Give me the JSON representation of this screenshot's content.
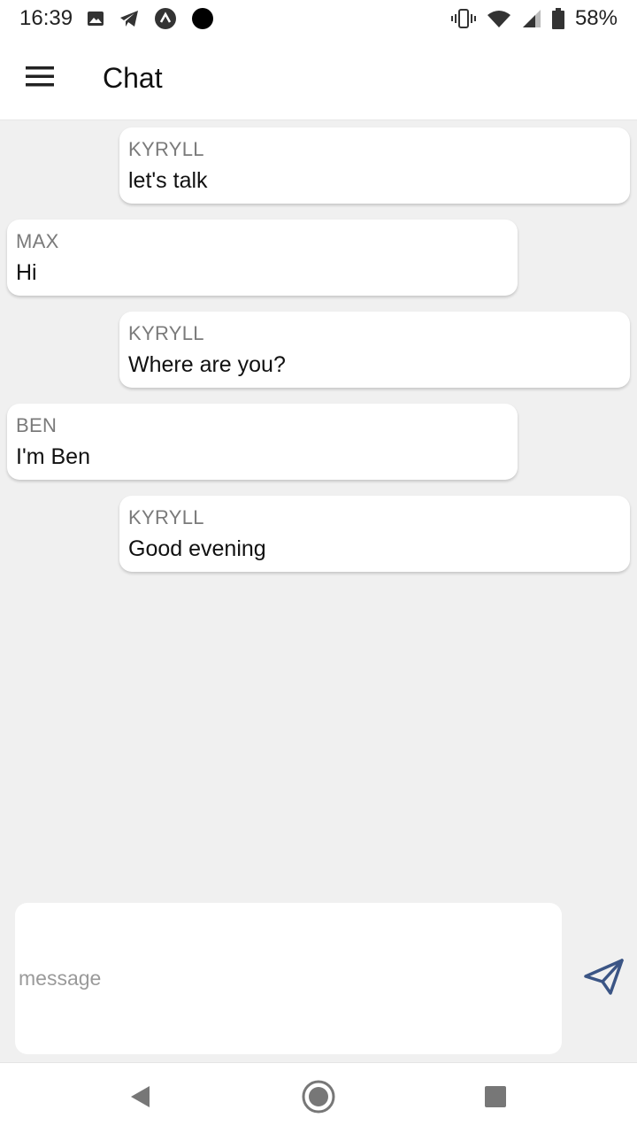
{
  "status_bar": {
    "time": "16:39",
    "battery": "58%",
    "icons": [
      "image-icon",
      "telegram-icon",
      "arc-icon",
      "dot-icon",
      "vibrate-icon",
      "wifi-icon",
      "signal-icon",
      "battery-icon"
    ]
  },
  "app_bar": {
    "title": "Chat",
    "menu_icon": "hamburger-menu-icon"
  },
  "messages": [
    {
      "sender": "KYRYLL",
      "text": "let's talk",
      "side": "right"
    },
    {
      "sender": "MAX",
      "text": "Hi",
      "side": "left"
    },
    {
      "sender": "KYRYLL",
      "text": "Where are you?",
      "side": "right"
    },
    {
      "sender": "BEN",
      "text": "I'm Ben",
      "side": "left"
    },
    {
      "sender": "KYRYLL",
      "text": "Good evening",
      "side": "right"
    }
  ],
  "composer": {
    "placeholder": "message",
    "value": "",
    "send_icon": "send-icon"
  },
  "nav_bar": {
    "icons": [
      "back-icon",
      "home-icon",
      "recents-icon"
    ]
  },
  "colors": {
    "background": "#f0f0f0",
    "bubble": "#ffffff",
    "sender": "#7a7a7a",
    "send_icon": "#3b5585"
  }
}
